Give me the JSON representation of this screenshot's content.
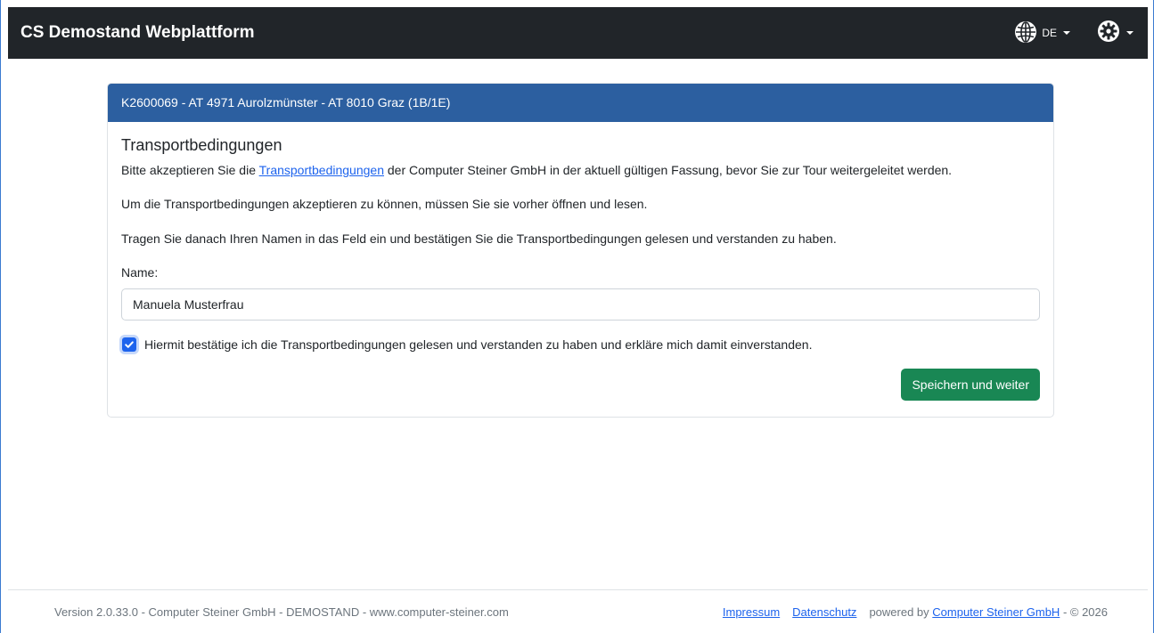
{
  "navbar": {
    "brand": "CS Demostand Webplattform",
    "language": "DE",
    "language_icon": "globe-icon",
    "settings_icon": "gear-icon"
  },
  "card": {
    "header": "K2600069 - AT 4971 Aurolzmünster - AT 8010 Graz (1B/1E)",
    "title": "Transportbedingungen",
    "p1_before": "Bitte akzeptieren Sie die ",
    "p1_link": "Transportbedingungen",
    "p1_after": " der Computer Steiner GmbH in der aktuell gültigen Fassung, bevor Sie zur Tour weitergeleitet werden.",
    "p2": "Um die Transportbedingungen akzeptieren zu können, müssen Sie sie vorher öffnen und lesen.",
    "p3": "Tragen Sie danach Ihren Namen in das Feld ein und bestätigen Sie die Transportbedingungen gelesen und verstanden zu haben.",
    "name_label": "Name:",
    "name_value": "Manuela Musterfrau",
    "checkbox_checked": true,
    "checkbox_label": "Hiermit bestätige ich die Transportbedingungen gelesen und verstanden zu haben und erkläre mich damit einverstanden.",
    "save_button": "Speichern und weiter"
  },
  "footer": {
    "version_text": "Version 2.0.33.0 - Computer Steiner GmbH - DEMOSTAND - www.computer-steiner.com",
    "impressum": "Impressum",
    "datenschutz": "Datenschutz",
    "powered_by": "powered by ",
    "company_link": "Computer Steiner GmbH",
    "copyright": " - © 2026"
  },
  "colors": {
    "navbar_bg": "#212529",
    "card_header_bg": "#2c5fa0",
    "primary": "#1d63ed",
    "success": "#198754"
  }
}
